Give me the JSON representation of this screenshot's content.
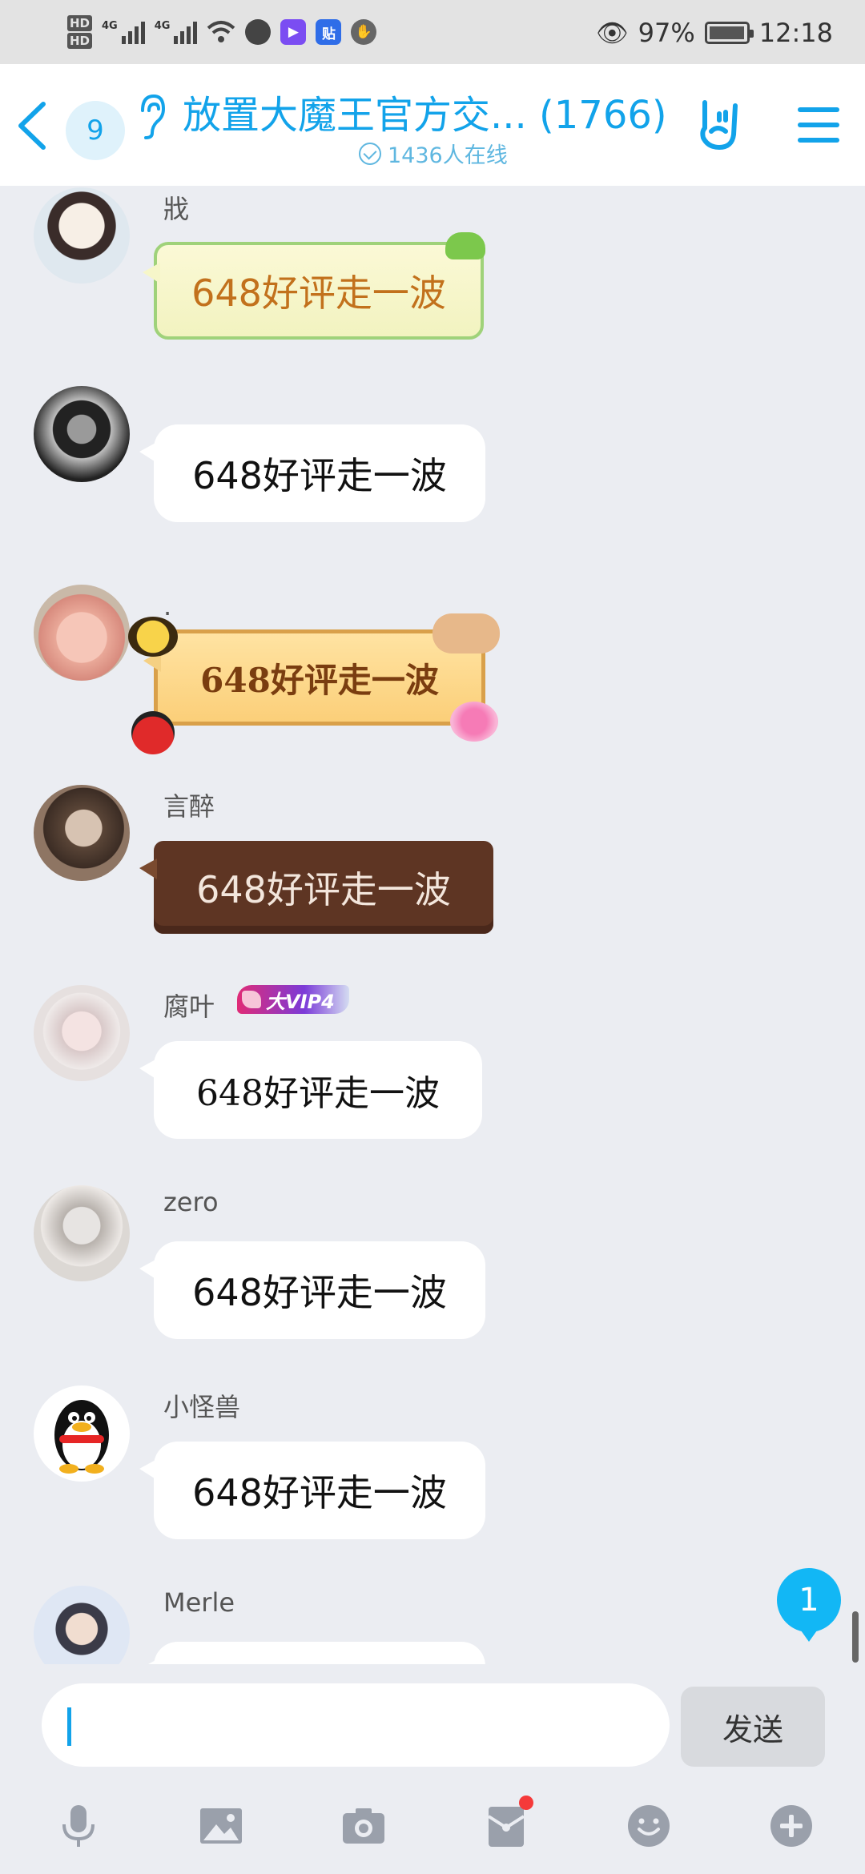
{
  "status_bar": {
    "hd_labels": [
      "HD",
      "HD"
    ],
    "network_labels": [
      "4G",
      "4G"
    ],
    "app_icons": [
      "globe-icon",
      "video-player-icon",
      "tieba-icon",
      "hand-stop-icon"
    ],
    "tieba_glyph": "贴",
    "eye_icon": "eye-icon",
    "battery_percent": "97%",
    "battery_level": 0.97,
    "time": "12:18"
  },
  "header": {
    "unread_count": "9",
    "title": "放置大魔王官方交... (1766)",
    "online_text": "1436人在线",
    "accent_color": "#12a3ea"
  },
  "messages": [
    {
      "sender": "戕",
      "text": "648好评走一波",
      "bubble_style": "green-nature"
    },
    {
      "sender": "",
      "text": "648好评走一波",
      "bubble_style": "plain"
    },
    {
      "sender": ".",
      "text": "648好评走一波",
      "bubble_style": "gold-bee"
    },
    {
      "sender": "言醉",
      "text": "648好评走一波",
      "bubble_style": "chocolate"
    },
    {
      "sender": "腐叶",
      "badge": "大VIP4",
      "text": "648好评走一波",
      "bubble_style": "handwritten"
    },
    {
      "sender": "zero",
      "text": "648好评走一波",
      "bubble_style": "plain"
    },
    {
      "sender": "小怪兽",
      "text": "648好评走一波",
      "bubble_style": "plain"
    },
    {
      "sender": "Merle",
      "text": "",
      "bubble_style": "plain"
    }
  ],
  "floating_unread": "1",
  "input": {
    "value": "",
    "send_label": "发送"
  },
  "toolbar": {
    "icons": [
      "microphone-icon",
      "image-icon",
      "camera-icon",
      "red-envelope-icon",
      "emoji-icon",
      "plus-icon"
    ]
  }
}
